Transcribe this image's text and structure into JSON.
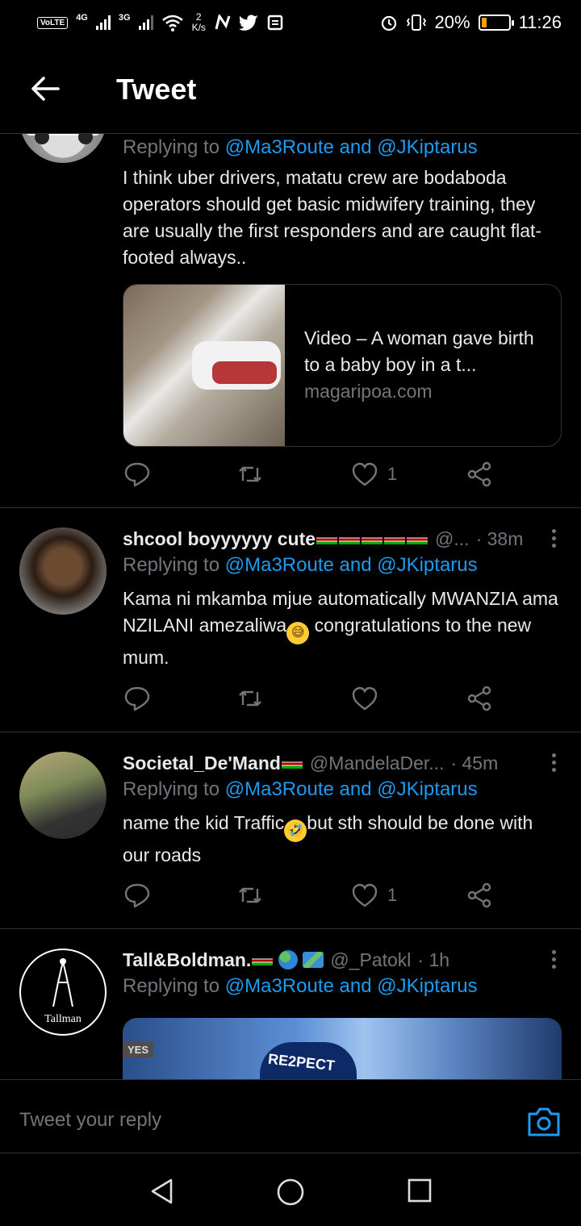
{
  "status": {
    "volte": "VoLTE",
    "net1": "4G",
    "net2": "3G",
    "speed_value": "2",
    "speed_unit": "K/s",
    "battery_pct": "20%",
    "battery_level": 0.2,
    "time": "11:26"
  },
  "header": {
    "title": "Tweet"
  },
  "tweets": [
    {
      "reply_prefix": "Replying to ",
      "reply_links": "@Ma3Route and @JKiptarus",
      "text": "I think uber drivers, matatu crew are bodaboda operators should get basic midwifery training, they are usually the first responders and are caught flat-footed always..",
      "card_title": "Video – A woman gave birth to a baby boy in a t...",
      "card_domain": "magaripoa.com",
      "likes": "1"
    },
    {
      "name": "shcool boyyyyyy cute",
      "handle": "@...",
      "time": "· 38m",
      "reply_prefix": "Replying to ",
      "reply_links": "@Ma3Route and @JKiptarus",
      "text_a": "Kama ni mkamba mjue automatically  MWANZIA ama NZILANI amezaliwa",
      "text_b": " congratulations to the new mum.",
      "likes": ""
    },
    {
      "name": "Societal_De'Mand",
      "handle": "@MandelaDer...",
      "time": "· 45m",
      "reply_prefix": "Replying to ",
      "reply_links": "@Ma3Route and @JKiptarus",
      "text_a": "name the kid Traffic",
      "text_b": "but sth should be done with our roads",
      "likes": "1"
    },
    {
      "name": "Tall&Boldman.",
      "handle": "@_Patokl",
      "time": "· 1h",
      "reply_prefix": "Replying to ",
      "reply_links": "@Ma3Route and @JKiptarus",
      "avatar_label": "Tallman",
      "media_tag": "YES",
      "media_text": "RE2PECT"
    }
  ],
  "reply": {
    "placeholder": "Tweet your reply"
  },
  "icons": {
    "back": "arrow-left-icon",
    "reply": "comment-icon",
    "retweet": "retweet-icon",
    "like": "heart-icon",
    "share": "share-icon",
    "camera": "camera-icon",
    "nav_back": "triangle-back-icon",
    "nav_home": "circle-home-icon",
    "nav_recent": "square-recents-icon"
  },
  "colors": {
    "link": "#1d9bf0",
    "muted": "#71767b",
    "text": "#e7e9ea",
    "background": "#000000"
  }
}
